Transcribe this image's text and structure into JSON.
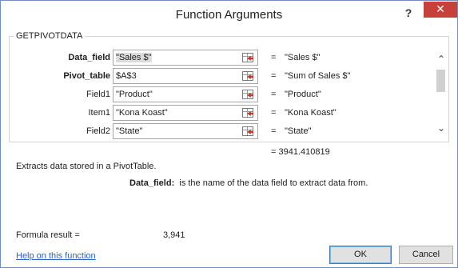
{
  "window": {
    "title": "Function Arguments",
    "help_glyph": "?",
    "close_glyph": "✕"
  },
  "function_name": "GETPIVOTDATA",
  "arguments": [
    {
      "label": "Data_field",
      "bold": true,
      "value": "\"Sales $\"",
      "result": "\"Sales $\""
    },
    {
      "label": "Pivot_table",
      "bold": true,
      "value": "$A$3",
      "result": "\"Sum of Sales $\""
    },
    {
      "label": "Field1",
      "bold": false,
      "value": "\"Product\"",
      "result": "\"Product\""
    },
    {
      "label": "Item1",
      "bold": false,
      "value": "\"Kona Koast\"",
      "result": "\"Kona Koast\""
    },
    {
      "label": "Field2",
      "bold": false,
      "value": "\"State\"",
      "result": "\"State\""
    }
  ],
  "equals_sign": "=",
  "overall_result": "= 3941.410819",
  "description": "Extracts data stored in a PivotTable.",
  "param_help": {
    "name": "Data_field:",
    "text": "is the name of the data field to extract data from."
  },
  "formula_result": {
    "label": "Formula result =",
    "value": "3,941"
  },
  "help_link": "Help on this function",
  "buttons": {
    "ok": "OK",
    "cancel": "Cancel"
  },
  "icons": {
    "ref": "collapse-dialog-icon",
    "scroll_up": "^",
    "scroll_down": "v"
  },
  "colors": {
    "close": "#c7403a",
    "link": "#2a62c9",
    "border": "#6e8fbf"
  }
}
